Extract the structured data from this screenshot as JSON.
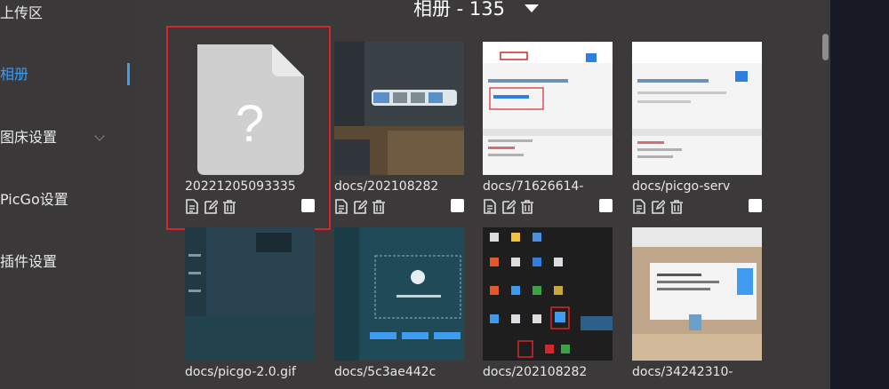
{
  "sidebar": {
    "items": [
      {
        "label": "上传区"
      },
      {
        "label": "相册",
        "active": true
      },
      {
        "label": "图床设置"
      },
      {
        "label": "PicGo设置"
      },
      {
        "label": "插件设置"
      }
    ]
  },
  "header": {
    "title": "相册 - 135"
  },
  "gallery": {
    "items": [
      {
        "filename": "20221205093335",
        "thumbnail": "unknown-file-icon",
        "selected_highlight": true
      },
      {
        "filename": "docs/202108282",
        "thumbnail": "picgo-upload-progress-screenshot"
      },
      {
        "filename": "docs/71626614-",
        "thumbnail": "browser-devtools-screenshot"
      },
      {
        "filename": "docs/picgo-serv",
        "thumbnail": "browser-devtools-screenshot"
      },
      {
        "filename": "docs/picgo-2.0.gif",
        "thumbnail": "picgo-app-screenshot"
      },
      {
        "filename": "docs/5c3ae442c",
        "thumbnail": "picgo-upload-dialog-screenshot"
      },
      {
        "filename": "docs/202108282",
        "thumbnail": "windows-tray-screenshot"
      },
      {
        "filename": "docs/34242310-",
        "thumbnail": "app-window-screenshot"
      }
    ]
  },
  "colors": {
    "accent": "#3f9bf0",
    "highlight_border": "#d6262b",
    "background": "#3a3838"
  }
}
